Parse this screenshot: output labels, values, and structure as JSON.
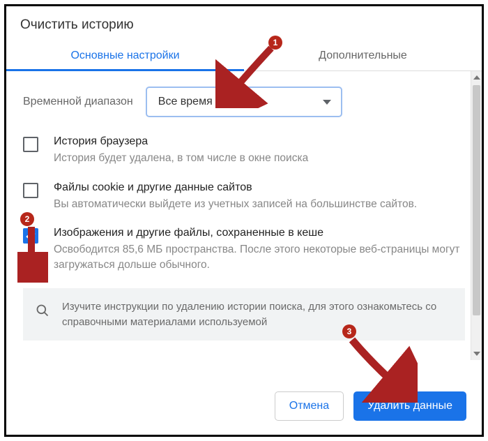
{
  "dialog": {
    "title": "Очистить историю"
  },
  "tabs": {
    "basic": "Основные настройки",
    "advanced": "Дополнительные"
  },
  "time_range": {
    "label": "Временной диапазон",
    "selected": "Все время"
  },
  "options": {
    "history": {
      "title": "История браузера",
      "desc": "История будет удалена, в том числе в окне поиска",
      "checked": false
    },
    "cookies": {
      "title": "Файлы cookie и другие данные сайтов",
      "desc": "Вы автоматически выйдете из учетных записей на большинстве сайтов.",
      "checked": false
    },
    "cache": {
      "title": "Изображения и другие файлы, сохраненные в кеше",
      "desc": "Освободится 85,6 МБ пространства. После этого некоторые веб-страницы могут загружаться дольше обычного.",
      "checked": true
    }
  },
  "info_box": {
    "text": "Изучите инструкции по удалению истории поиска, для этого ознакомьтесь со справочными материалами используемой"
  },
  "footer": {
    "cancel": "Отмена",
    "confirm": "Удалить данные"
  },
  "annotations": {
    "b1": "1",
    "b2": "2",
    "b3": "3"
  }
}
